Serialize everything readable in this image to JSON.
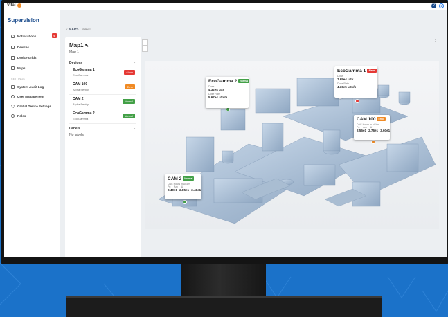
{
  "app": {
    "brand": "Vital"
  },
  "sidebar": {
    "title": "Supervision",
    "items": [
      {
        "label": "Notifications",
        "icon": "bell-icon",
        "badge": "9"
      },
      {
        "label": "Devices",
        "icon": "device-icon"
      },
      {
        "label": "Device Grids",
        "icon": "grid-icon"
      },
      {
        "label": "Maps",
        "icon": "map-icon"
      }
    ],
    "settings_heading": "SETTINGS",
    "settings_items": [
      {
        "label": "System Audit Log",
        "icon": "document-icon"
      },
      {
        "label": "User Management",
        "icon": "users-icon"
      },
      {
        "label": "Global Device Settings",
        "icon": "gear-icon"
      },
      {
        "label": "Roles",
        "icon": "roles-icon"
      }
    ]
  },
  "breadcrumb": {
    "root": "MAPS",
    "sep": "/",
    "current": "MAP1"
  },
  "panel": {
    "title": "Map1",
    "subtitle": "Map 1",
    "devices_heading": "Devices",
    "devices": [
      {
        "name": "EcoGamma 1",
        "model": "Eco Gamma",
        "status": "Alarm",
        "color": "#e53935"
      },
      {
        "name": "CAM 100",
        "model": "Alpha Sentry",
        "status": "Error",
        "color": "#f08a24"
      },
      {
        "name": "CAM 2",
        "model": "Alpha Sentry",
        "status": "Normal",
        "color": "#43a047"
      },
      {
        "name": "EcoGamma 2",
        "model": "Eco Gamma",
        "status": "Normal",
        "color": "#43a047"
      }
    ],
    "labels_heading": "Labels",
    "labels_empty": "No labels"
  },
  "map_controls": {
    "zoom_in": "+",
    "zoom_out": "−",
    "fullscreen": "⛶"
  },
  "popups": {
    "eg2": {
      "name": "EcoGamma 2",
      "status": "Normal",
      "dose_label": "Dose",
      "dose": "4.32e4 μSv",
      "rate_label": "Dose Rate",
      "rate": "5.67e4 μSv/h"
    },
    "eg1": {
      "name": "EcoGamma 1",
      "status": "Alarm",
      "dose_label": "Dose",
      "dose": "7.65e4 μSv",
      "rate_label": "Dose Rate",
      "rate": "4.36e5 μSv/h"
    },
    "cam100": {
      "name": "CAM 100",
      "status": "Error",
      "sub": "DAC Hours in μCi/m",
      "h1": "Pu",
      "h2": "Am",
      "h3": "U",
      "v1": "2.55e1",
      "v2": "2.76e1",
      "v3": "3.60e1"
    },
    "cam2": {
      "name": "CAM 2",
      "status": "Normal",
      "sub": "DAC Hours in μCi/m",
      "h1": "Pu",
      "h2": "Am",
      "h3": "U",
      "v1": "2.40e1",
      "v2": "2.85e1",
      "v3": "3.48e1"
    }
  },
  "colors": {
    "alarm": "#e53935",
    "error": "#f08a24",
    "normal": "#43a047",
    "brand": "#1a4b8c"
  }
}
